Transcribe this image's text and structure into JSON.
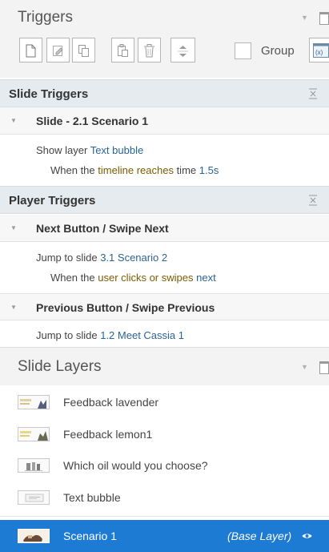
{
  "triggers_panel": {
    "title": "Triggers",
    "group_label": "Group"
  },
  "slide_triggers": {
    "header": "Slide Triggers",
    "group": "Slide - 2.1 Scenario 1",
    "action_prefix": "Show layer",
    "action_target": "Text bubble",
    "cond_when": "When the",
    "cond_event": "timeline reaches",
    "cond_time": "time",
    "cond_value": "1.5s"
  },
  "player_triggers": {
    "header": "Player Triggers",
    "next_group": "Next Button / Swipe Next",
    "next_action_prefix": "Jump to slide",
    "next_action_target": "3.1 Scenario 2",
    "next_cond_when": "When the",
    "next_cond_event": "user clicks or swipes",
    "next_cond_target": "next",
    "prev_group": "Previous Button / Swipe Previous",
    "prev_action_prefix": "Jump to slide",
    "prev_action_target": "1.2 Meet Cassia 1"
  },
  "slide_layers": {
    "title": "Slide Layers",
    "items": [
      {
        "name": "Feedback lavender"
      },
      {
        "name": "Feedback lemon1"
      },
      {
        "name": "Which oil would you choose?"
      },
      {
        "name": "Text bubble"
      }
    ],
    "base": {
      "name": "Scenario 1",
      "tag": "(Base Layer)"
    }
  },
  "colors": {
    "selection": "#1e7bd4",
    "link": "#2a6496",
    "section_bg": "#e6ebef"
  }
}
